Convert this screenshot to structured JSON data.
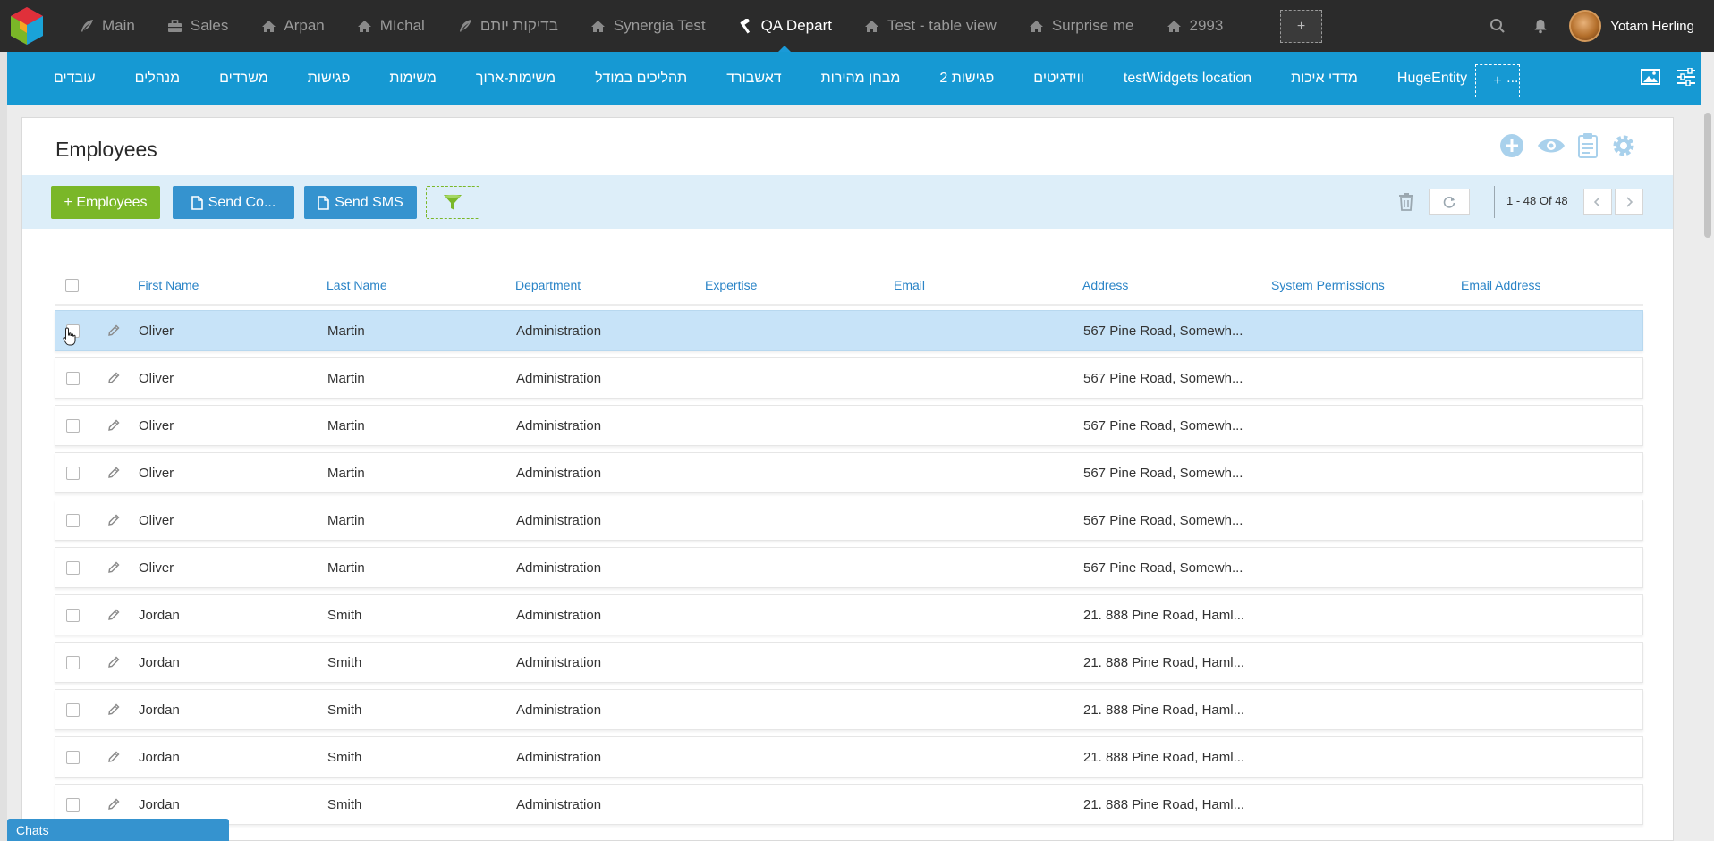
{
  "top_tabs": [
    {
      "label": "Main",
      "icon": "feather-icon"
    },
    {
      "label": "Sales",
      "icon": "briefcase-icon"
    },
    {
      "label": "Arpan",
      "icon": "home-icon"
    },
    {
      "label": "MIchal",
      "icon": "home-icon"
    },
    {
      "label": "בדיקות יותם",
      "icon": "feather-icon"
    },
    {
      "label": "Synergia Test",
      "icon": "home-icon"
    },
    {
      "label": "QA Depart",
      "icon": "hammer-icon",
      "active": true
    },
    {
      "label": "Test - table view",
      "icon": "home-icon"
    },
    {
      "label": "Surprise me",
      "icon": "home-icon"
    },
    {
      "label": "2993",
      "icon": "home-icon"
    }
  ],
  "top_add_label": "+",
  "user": {
    "name": "Yotam Herling"
  },
  "blue_tabs": [
    "עובדים",
    "מנהלים",
    "משרדים",
    "פגישות",
    "משימות",
    "משימות-ארוך",
    "תהליכים במודל",
    "דאשבורד",
    "מבחן מהירות",
    "פגישות 2",
    "ווידגיטים",
    "testWidgets location",
    "מדדי איכות",
    "HugeEntity",
    "..."
  ],
  "blue_add_label": "+",
  "panel": {
    "title": "Employees"
  },
  "toolbar": {
    "add_label": "+ Employees",
    "send_doc_label": "Send Co...",
    "send_sms_label": "Send SMS",
    "pager_text": "1 - 48 Of 48"
  },
  "columns": [
    "First Name",
    "Last Name",
    "Department",
    "Expertise",
    "Email",
    "Address",
    "System Permissions",
    "Email Address"
  ],
  "rows": [
    {
      "first": "Oliver",
      "last": "Martin",
      "dept": "Administration",
      "expertise": "",
      "email": "",
      "address": "567 Pine Road, Somewh...",
      "permissions": "",
      "email_address": "",
      "selected": true
    },
    {
      "first": "Oliver",
      "last": "Martin",
      "dept": "Administration",
      "expertise": "",
      "email": "",
      "address": "567 Pine Road, Somewh...",
      "permissions": "",
      "email_address": ""
    },
    {
      "first": "Oliver",
      "last": "Martin",
      "dept": "Administration",
      "expertise": "",
      "email": "",
      "address": "567 Pine Road, Somewh...",
      "permissions": "",
      "email_address": ""
    },
    {
      "first": "Oliver",
      "last": "Martin",
      "dept": "Administration",
      "expertise": "",
      "email": "",
      "address": "567 Pine Road, Somewh...",
      "permissions": "",
      "email_address": ""
    },
    {
      "first": "Oliver",
      "last": "Martin",
      "dept": "Administration",
      "expertise": "",
      "email": "",
      "address": "567 Pine Road, Somewh...",
      "permissions": "",
      "email_address": ""
    },
    {
      "first": "Oliver",
      "last": "Martin",
      "dept": "Administration",
      "expertise": "",
      "email": "",
      "address": "567 Pine Road, Somewh...",
      "permissions": "",
      "email_address": ""
    },
    {
      "first": "Jordan",
      "last": "Smith",
      "dept": "Administration",
      "expertise": "",
      "email": "",
      "address": "21. 888 Pine Road, Haml...",
      "permissions": "",
      "email_address": ""
    },
    {
      "first": "Jordan",
      "last": "Smith",
      "dept": "Administration",
      "expertise": "",
      "email": "",
      "address": "21. 888 Pine Road, Haml...",
      "permissions": "",
      "email_address": ""
    },
    {
      "first": "Jordan",
      "last": "Smith",
      "dept": "Administration",
      "expertise": "",
      "email": "",
      "address": "21. 888 Pine Road, Haml...",
      "permissions": "",
      "email_address": ""
    },
    {
      "first": "Jordan",
      "last": "Smith",
      "dept": "Administration",
      "expertise": "",
      "email": "",
      "address": "21. 888 Pine Road, Haml...",
      "permissions": "",
      "email_address": ""
    },
    {
      "first": "Jordan",
      "last": "Smith",
      "dept": "Administration",
      "expertise": "",
      "email": "",
      "address": "21. 888 Pine Road, Haml...",
      "permissions": "",
      "email_address": ""
    }
  ],
  "chats_label": "Chats",
  "colors": {
    "top_bar": "#2b2b2b",
    "blue_bar": "#1699d3",
    "add_button": "#7ab728",
    "action_button": "#3593cf",
    "header_text": "#2a84c7",
    "selected_row": "#c7e3f8"
  }
}
